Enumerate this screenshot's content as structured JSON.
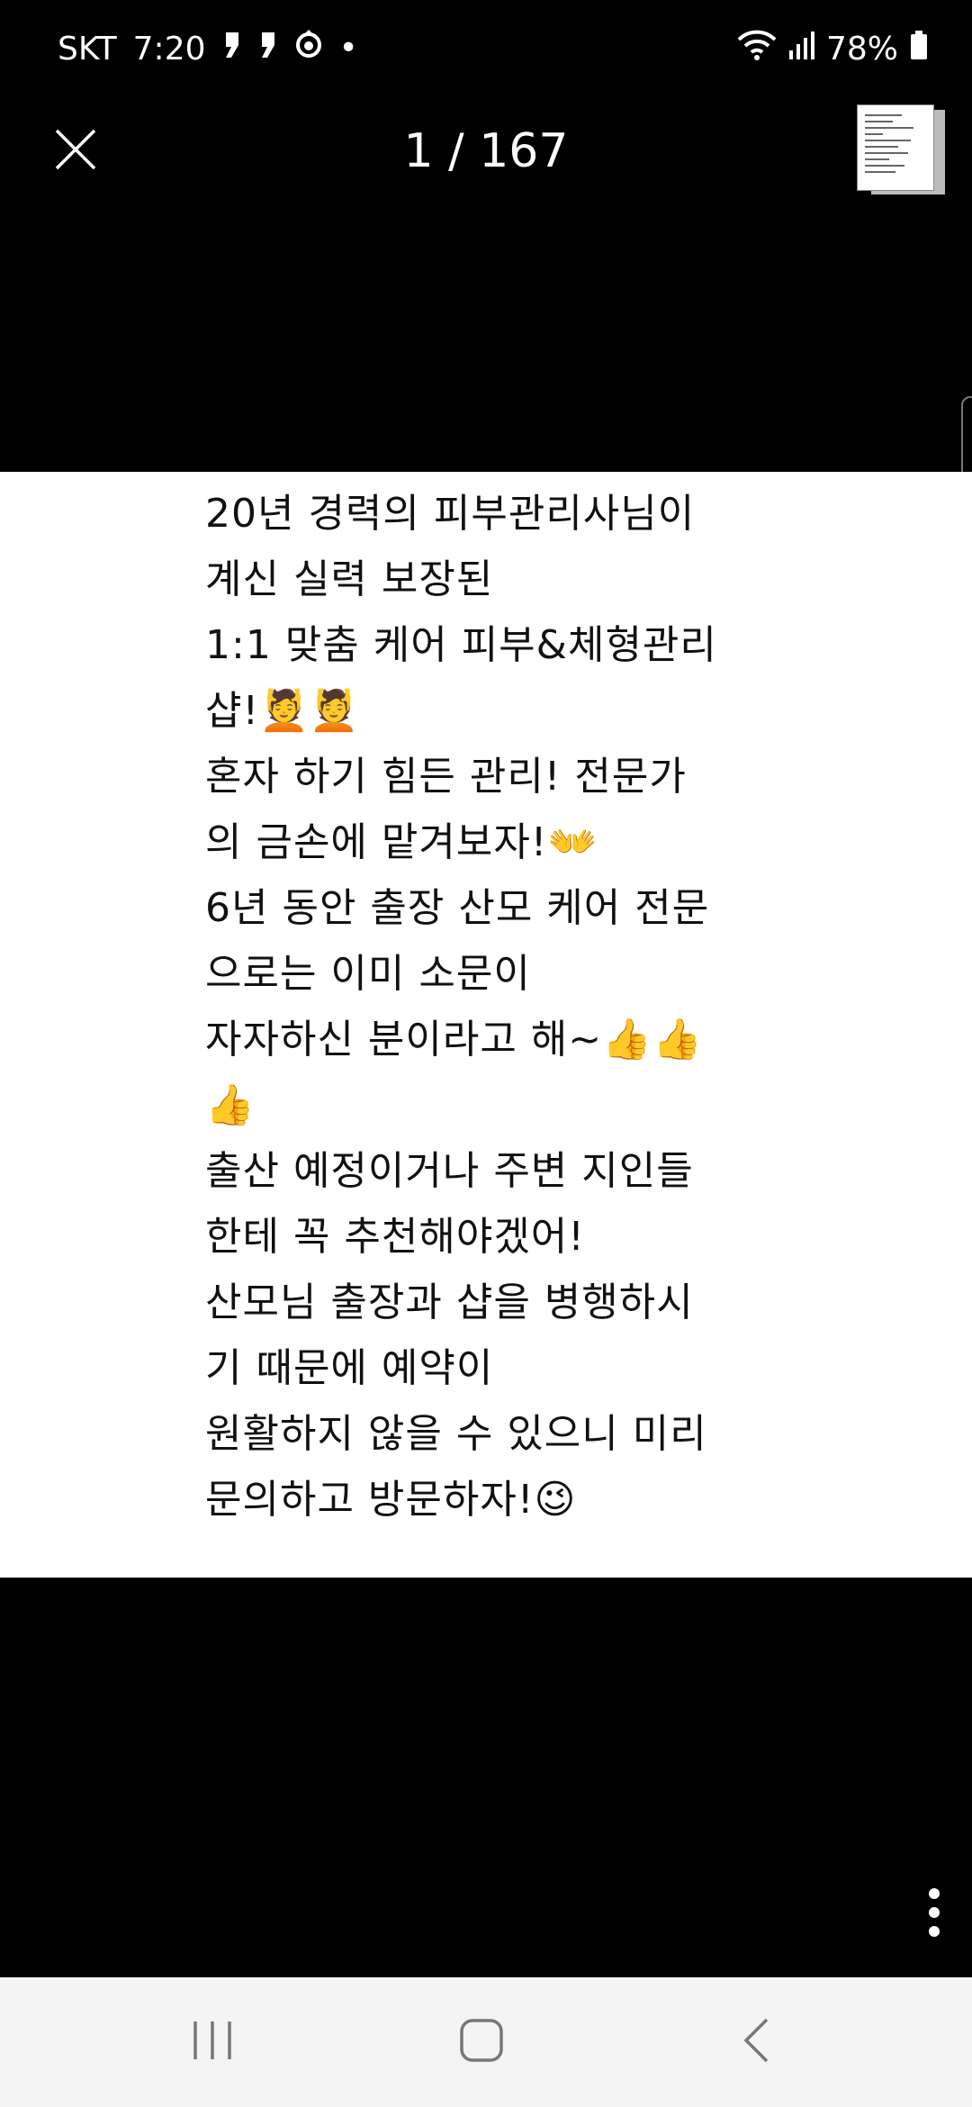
{
  "status_bar": {
    "carrier": "SKT",
    "time": "7:20",
    "notification_icons": [
      "message-icon",
      "message-icon",
      "location-icon"
    ],
    "more_notifications": "•",
    "wifi_icon": "wifi-icon",
    "signal_icon": "signal-icon",
    "battery": "78%",
    "battery_icon": "battery-icon"
  },
  "viewer": {
    "close_icon": "close-icon",
    "page_counter": "1 / 167",
    "thumbnail_icon": "thumbnail-stack-icon",
    "more_icon": "more-vertical-icon"
  },
  "page": {
    "lines": [
      "20년 경력의 피부관리사님이",
      "계신 실력 보장된",
      "1:1 맞춤 케어 피부&체형관리",
      "샵!💆💆",
      "혼자 하기 힘든 관리! 전문가",
      "의 금손에 맡겨보자!👐",
      "6년 동안 출장 산모 케어 전문",
      "으로는 이미 소문이",
      "자자하신 분이라고 해~👍👍",
      "👍",
      "출산 예정이거나 주변 지인들",
      "한테 꼭 추천해야겠어!",
      "산모님 출장과 샵을 병행하시",
      "기 때문에 예약이",
      "원활하지 않을 수 있으니 미리",
      "문의하고 방문하자!😉"
    ]
  },
  "nav_bar": {
    "recents_icon": "recents-icon",
    "home_icon": "home-icon",
    "back_icon": "back-icon"
  },
  "colors": {
    "background": "#000000",
    "page_background": "#ffffff",
    "text": "#111111",
    "nav_bar": "#f4f4f4"
  }
}
